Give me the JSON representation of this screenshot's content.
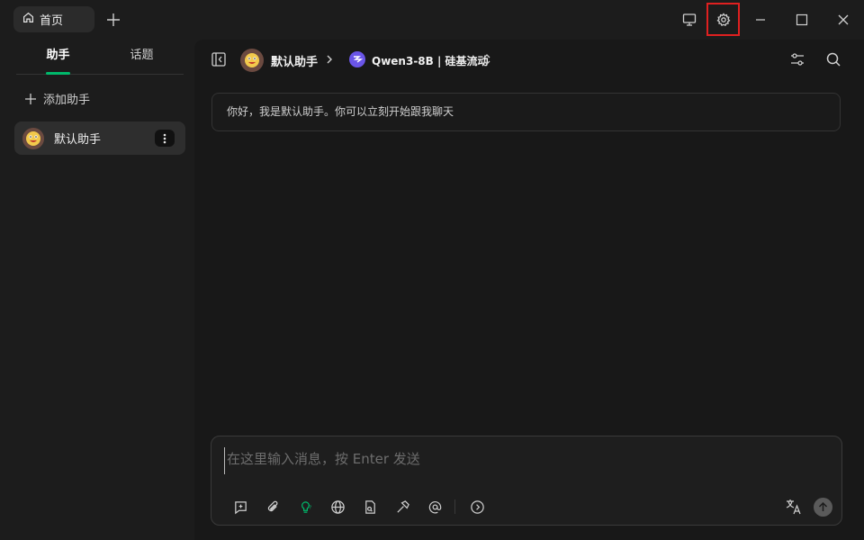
{
  "titlebar": {
    "home_tab_label": "首页",
    "icons": [
      "home-icon",
      "plus-icon",
      "monitor-icon",
      "gear-icon",
      "minimize-icon",
      "maximize-icon",
      "close-icon"
    ]
  },
  "sidebar": {
    "tabs": [
      {
        "label": "助手",
        "active": true
      },
      {
        "label": "话题",
        "active": false
      }
    ],
    "add_assistant_label": "添加助手",
    "assistants": [
      {
        "name": "默认助手",
        "selected": true
      }
    ]
  },
  "header": {
    "assistant_name": "默认助手",
    "model_name": "Qwen3-8B | 硅基流动"
  },
  "chat": {
    "greeting": "你好，我是默认助手。你可以立刻开始跟我聊天"
  },
  "input": {
    "placeholder": "在这里输入消息，按 Enter 发送",
    "value": "",
    "tools": [
      "new-topic-icon",
      "attachment-icon",
      "bulb-icon",
      "globe-icon",
      "knowledge-icon",
      "hammer-icon",
      "mention-icon",
      "chevron-circle-icon"
    ]
  },
  "colors": {
    "accent": "#00b96b",
    "background": "#1c1c1c",
    "main_background": "#181818",
    "highlight": "#e02020"
  }
}
